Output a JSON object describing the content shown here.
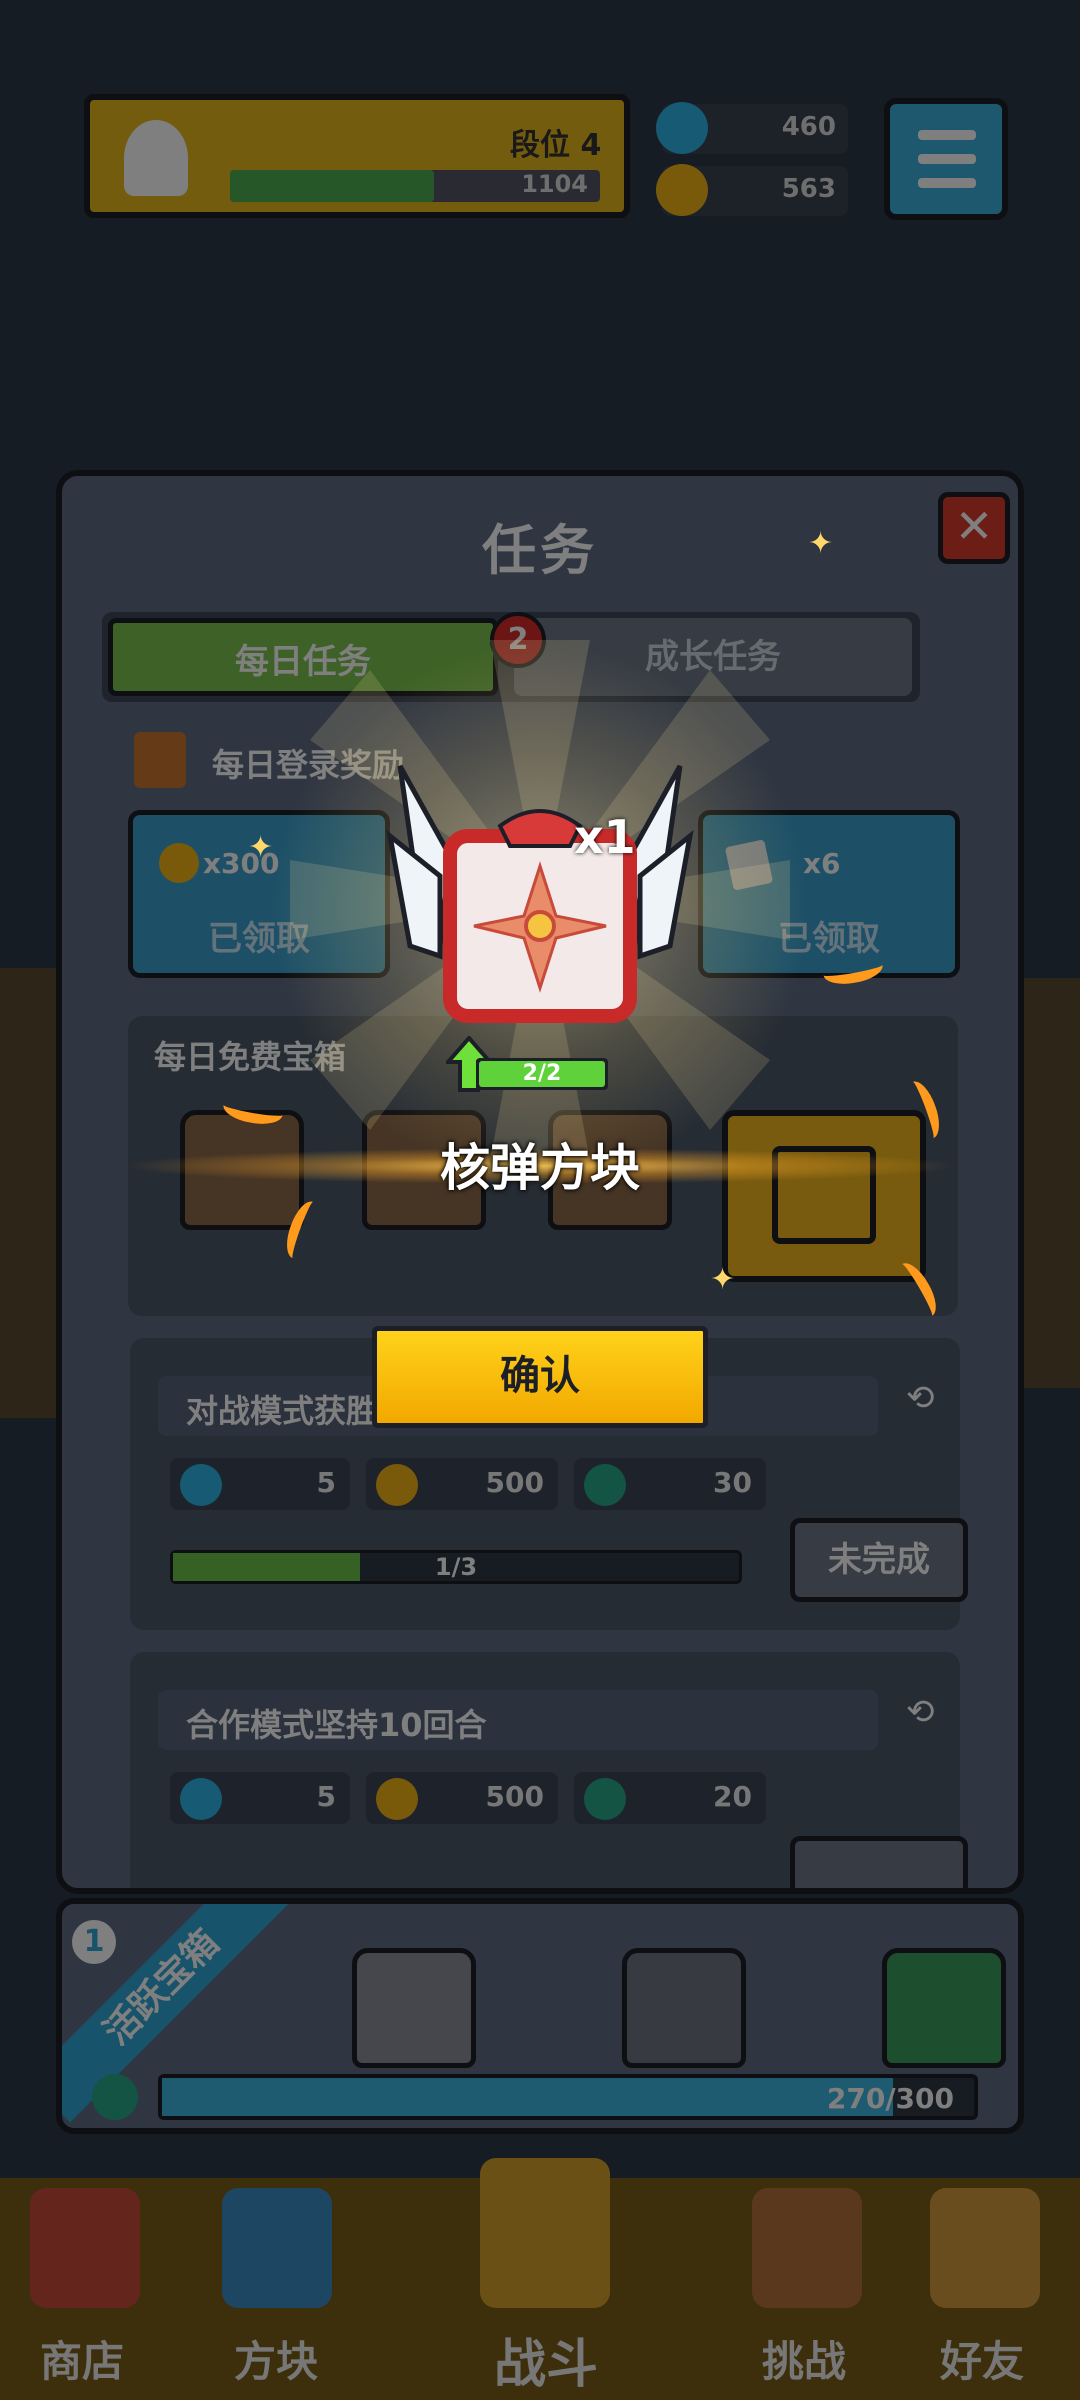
{
  "topbar": {
    "rank_label": "段位 4",
    "xp_value": "1104",
    "gems": "460",
    "coins": "563"
  },
  "task_panel": {
    "title": "任务",
    "close_glyph": "✕",
    "tabs": [
      {
        "label": "每日任务",
        "badge": "2"
      },
      {
        "label": "成长任务"
      }
    ],
    "login_reward": {
      "title": "每日登录奖励",
      "cards": [
        {
          "qty": "x300",
          "status": "已领取",
          "icon": "coin-icon"
        },
        {
          "qty": "",
          "status": "",
          "icon": "gift-icon"
        },
        {
          "qty": "x6",
          "status": "已领取",
          "icon": "card-icon"
        }
      ]
    },
    "free_chest": {
      "title": "每日免费宝箱"
    },
    "tasks": [
      {
        "title": "对战模式获胜",
        "rewards": [
          "5",
          "500",
          "30"
        ],
        "progress_text": "1/3",
        "progress": 0.33,
        "status": "未完成"
      },
      {
        "title": "合作模式坚持10回合",
        "rewards": [
          "5",
          "500",
          "20"
        ]
      }
    ]
  },
  "activity": {
    "ribbon": "活跃宝箱",
    "ribbon_num": "1",
    "progress_text": "270/300",
    "progress": 0.9
  },
  "bottom_nav": [
    "商店",
    "方块",
    "战斗",
    "挑战",
    "好友"
  ],
  "reward_popup": {
    "quantity": "x1",
    "level_text": "2/2",
    "level_progress": 1.0,
    "item_name": "核弹方块",
    "confirm_label": "确认"
  },
  "colors": {
    "accent_yellow": "#ffc60a",
    "confirm_border": "#1c1f27",
    "item_red": "#e94949"
  }
}
